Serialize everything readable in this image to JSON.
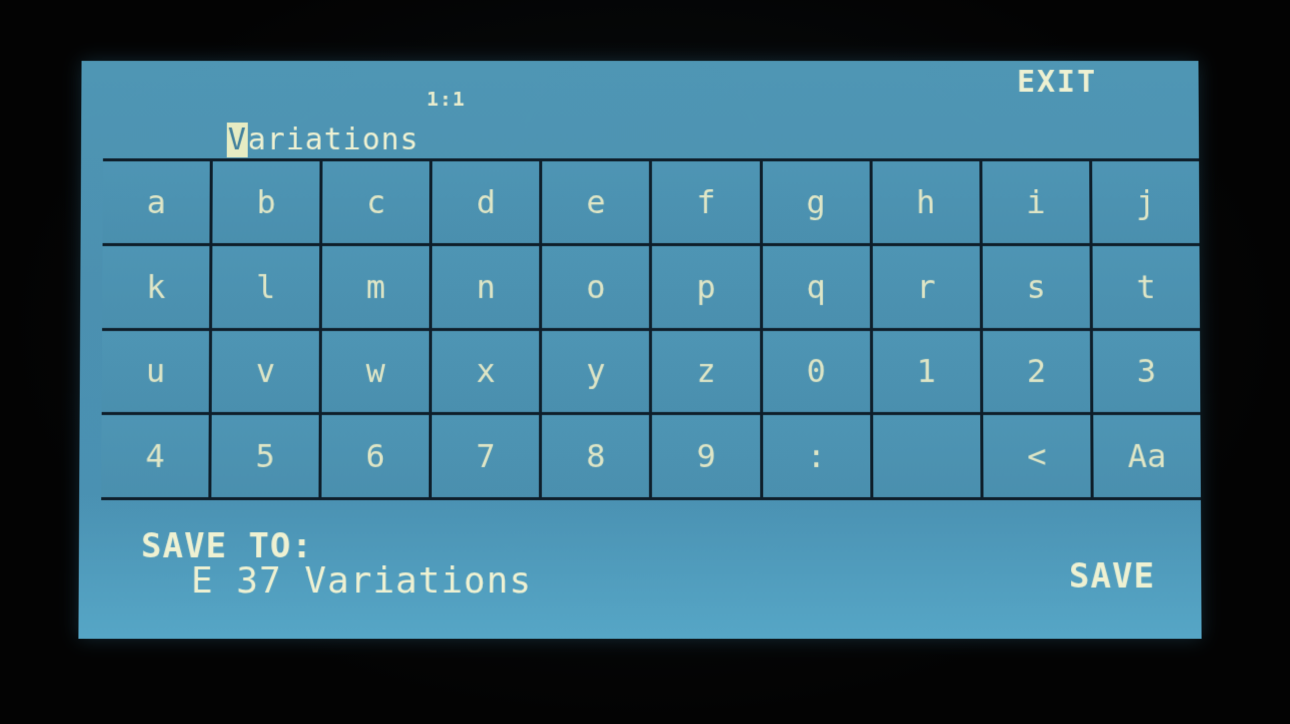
{
  "header": {
    "position": "1:1",
    "exit_label": "EXIT",
    "name_first_char": "V",
    "name_rest": "ariations"
  },
  "keyboard": {
    "rows": [
      [
        "a",
        "b",
        "c",
        "d",
        "e",
        "f",
        "g",
        "h",
        "i",
        "j"
      ],
      [
        "k",
        "l",
        "m",
        "n",
        "o",
        "p",
        "q",
        "r",
        "s",
        "t"
      ],
      [
        "u",
        "v",
        "w",
        "x",
        "y",
        "z",
        "0",
        "1",
        "2",
        "3"
      ],
      [
        "4",
        "5",
        "6",
        "7",
        "8",
        "9",
        ":",
        "",
        "<",
        "Aa"
      ]
    ]
  },
  "footer": {
    "save_to_label": "SAVE TO:",
    "save_target": "E 37 Variations",
    "save_label": "SAVE"
  },
  "colors": {
    "screen_bg": "#4b90b0",
    "text": "#eef1d2",
    "grid_lines": "#0e1e2a"
  }
}
